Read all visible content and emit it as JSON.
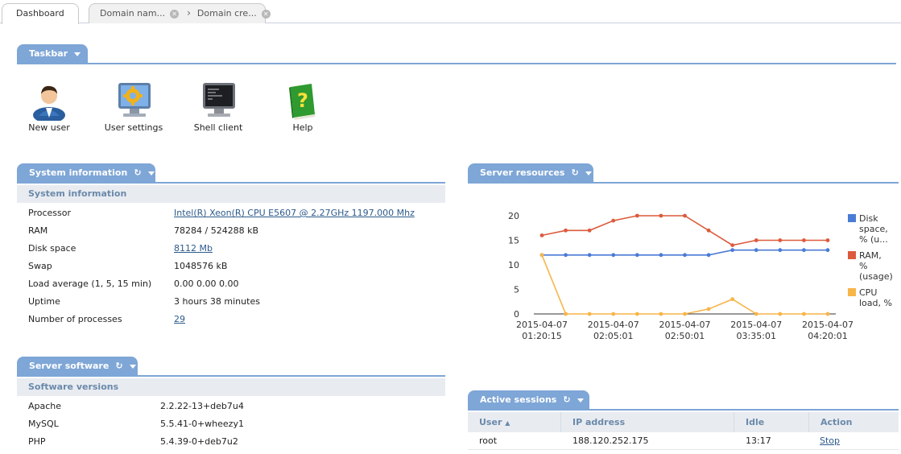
{
  "tabs": {
    "dashboard": "Dashboard",
    "domain_names": "Domain nam...",
    "domain_create": "Domain cre..."
  },
  "taskbar": {
    "title": "Taskbar",
    "items": [
      {
        "label": "New user",
        "icon": "user-icon"
      },
      {
        "label": "User settings",
        "icon": "settings-monitor-icon"
      },
      {
        "label": "Shell client",
        "icon": "terminal-icon"
      },
      {
        "label": "Help",
        "icon": "help-book-icon"
      }
    ]
  },
  "system_info": {
    "title": "System information",
    "subtitle": "System information",
    "rows": [
      {
        "label": "Processor",
        "value": "Intel(R) Xeon(R) CPU E5607 @ 2.27GHz 1197.000 Mhz",
        "link": true
      },
      {
        "label": "RAM",
        "value": "78284 / 524288 kB",
        "link": false
      },
      {
        "label": "Disk space",
        "value": "8112 Mb",
        "link": true
      },
      {
        "label": "Swap",
        "value": "1048576 kB",
        "link": false
      },
      {
        "label": "Load average (1, 5, 15 min)",
        "value": "0.00 0.00 0.00",
        "link": false
      },
      {
        "label": "Uptime",
        "value": "3 hours 38 minutes",
        "link": false
      },
      {
        "label": "Number of processes",
        "value": "29",
        "link": true
      }
    ]
  },
  "server_software": {
    "title": "Server software",
    "subtitle": "Software versions",
    "rows": [
      {
        "label": "Apache",
        "value": "2.2.22-13+deb7u4"
      },
      {
        "label": "MySQL",
        "value": "5.5.41-0+wheezy1"
      },
      {
        "label": "PHP",
        "value": "5.4.39-0+deb7u2"
      }
    ]
  },
  "server_resources": {
    "title": "Server resources"
  },
  "chart_data": {
    "type": "line",
    "x": [
      "2015-04-07 01:20:15",
      "",
      "",
      "",
      "",
      "2015-04-07 02:05:01",
      "",
      "",
      "",
      "",
      "2015-04-07 02:50:01",
      "",
      "",
      "",
      "",
      "2015-04-07 03:35:01",
      "",
      "",
      "",
      "",
      "2015-04-07 04:20:01"
    ],
    "x_tick_labels": [
      {
        "date": "2015-04-07",
        "time": "01:20:15"
      },
      {
        "date": "2015-04-07",
        "time": "02:05:01"
      },
      {
        "date": "2015-04-07",
        "time": "02:50:01"
      },
      {
        "date": "2015-04-07",
        "time": "03:35:01"
      },
      {
        "date": "2015-04-07",
        "time": "04:20:01"
      }
    ],
    "y_ticks": [
      "0",
      "5",
      "10",
      "15",
      "20"
    ],
    "ylim": [
      0,
      20
    ],
    "series": [
      {
        "name": "Disk space, % (u...",
        "color": "#4a7bd6",
        "values": [
          12,
          12,
          12,
          12,
          12,
          12,
          12,
          12,
          13,
          13,
          13,
          13,
          13
        ]
      },
      {
        "name": "RAM, % (usage)",
        "color": "#dc5a3c",
        "values": [
          16,
          17,
          17,
          19,
          20,
          20,
          20,
          17,
          14,
          15,
          15,
          15,
          15
        ]
      },
      {
        "name": "CPU load, %",
        "color": "#f7b54a",
        "values": [
          12,
          0,
          0,
          0,
          0,
          0,
          0,
          1,
          3,
          0,
          0,
          0,
          0
        ]
      }
    ],
    "legend": [
      {
        "lines": [
          "Disk",
          "space,",
          "% (u..."
        ]
      },
      {
        "lines": [
          "RAM,",
          "%",
          "(usage)"
        ]
      },
      {
        "lines": [
          "CPU",
          "load, %"
        ]
      }
    ],
    "grid": false,
    "legend_position": "right"
  },
  "sessions": {
    "title": "Active sessions",
    "columns": [
      "User",
      "IP address",
      "Idle",
      "Action"
    ],
    "rows": [
      {
        "user": "root",
        "ip": "188.120.252.175",
        "idle": "13:17",
        "action": "Stop"
      }
    ]
  }
}
